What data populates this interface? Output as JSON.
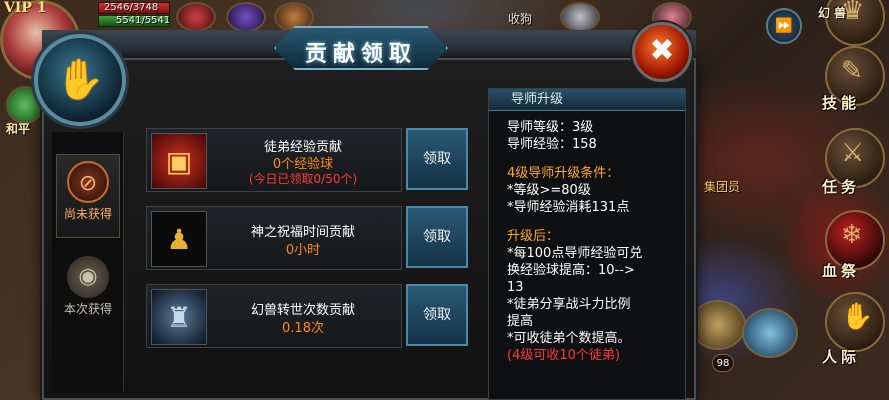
{
  "hud": {
    "vip_label": "VIP 1",
    "hp_text": "2546/3748",
    "mp_text": "5541/5541",
    "buff_label": "和平",
    "world_text_1": "收狗",
    "world_text_2": "集团员"
  },
  "dialog": {
    "title": "贡献领取",
    "emblem_icon": "handshake-icon",
    "close_icon": "close-icon"
  },
  "tabs": [
    {
      "label": "尚未获得",
      "icon": "locked-reward-icon",
      "active": true
    },
    {
      "label": "本次获得",
      "icon": "money-bag-icon",
      "active": false
    }
  ],
  "rewards": [
    {
      "icon": "exp-chest-icon",
      "title": "徒弟经验贡献",
      "value": "0个经验球",
      "note": "(今日已领取0/50个)",
      "button": "领取"
    },
    {
      "icon": "golden-statue-icon",
      "title": "神之祝福时间贡献",
      "value": "0小时",
      "button": "领取"
    },
    {
      "icon": "armored-beast-icon",
      "title": "幻兽转世次数贡献",
      "value": "0.18次",
      "button": "领取"
    }
  ],
  "mentor_panel": {
    "header": "导师升级",
    "lines": [
      {
        "text": "导师等级：3级",
        "color": "white"
      },
      {
        "text": "导师经验：158",
        "color": "white"
      },
      {
        "text": "",
        "color": "spacer"
      },
      {
        "text": "4级导师升级条件：",
        "color": "orange"
      },
      {
        "text": "*等级>=80级",
        "color": "white"
      },
      {
        "text": "*导师经验消耗131点",
        "color": "white"
      },
      {
        "text": "",
        "color": "spacer"
      },
      {
        "text": "升级后：",
        "color": "orange"
      },
      {
        "text": "*每100点导师经验可兑",
        "color": "white"
      },
      {
        "text": "换经验球提高：10-->",
        "color": "white"
      },
      {
        "text": "13",
        "color": "white"
      },
      {
        "text": "*徒弟分享战斗力比例",
        "color": "white"
      },
      {
        "text": "提高",
        "color": "white"
      },
      {
        "text": "*可收徒弟个数提高。",
        "color": "white"
      },
      {
        "text": "(4级可收10个徒弟)",
        "color": "red"
      }
    ]
  },
  "side_menu": [
    {
      "label": "幻兽",
      "icon": "beast-icon"
    },
    {
      "label": "技能",
      "icon": "spellbook-icon"
    },
    {
      "label": "任务",
      "icon": "quest-icon"
    },
    {
      "label": "血祭",
      "icon": "blood-sacrifice-icon"
    },
    {
      "label": "人际",
      "icon": "social-icon"
    }
  ],
  "skill_bar": {
    "level_badge": "98",
    "fast_forward_icon": "fast-forward-icon"
  },
  "colors": {
    "accent_blue": "#2a5a74",
    "value_orange": "#ff8a1a",
    "warning_red": "#ff3a3a"
  }
}
